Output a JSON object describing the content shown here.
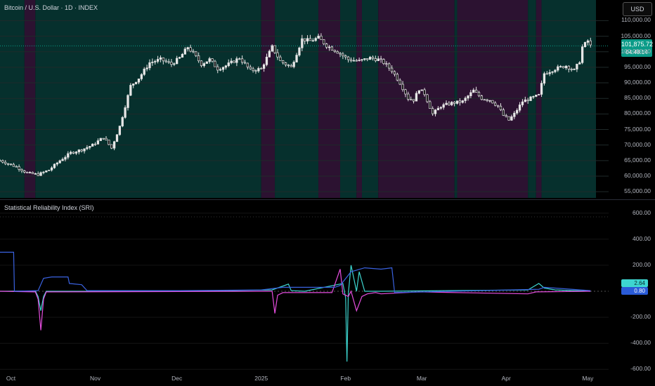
{
  "header": {
    "symbol_title": "Bitcoin / U.S. Dollar · 1D · INDEX",
    "currency_button": "USD",
    "indicator_title": "Statistical Reliability Index (SRI)"
  },
  "price_tag": {
    "value": "101,875.72",
    "countdown": "04:48:14"
  },
  "value_tags": {
    "a": "2.64",
    "b": "0.80"
  },
  "colors": {
    "bull_regime": "#06302d",
    "bear_regime": "#2c1231",
    "candle": "#e6e6e6",
    "line_cyan": "#3dd6d0",
    "line_magenta": "#e64ddf",
    "line_blue": "#3a62e0",
    "accent": "#0b9b88"
  },
  "chart_data": [
    {
      "type": "candlestick",
      "title": "Bitcoin / U.S. Dollar · 1D · INDEX",
      "ylim": [
        53000,
        111000
      ],
      "y_ticks": [
        "110,000.00",
        "105,000.00",
        "100,000.00",
        "95,000.00",
        "90,000.00",
        "85,000.00",
        "80,000.00",
        "75,000.00",
        "70,000.00",
        "65,000.00",
        "60,000.00",
        "55,000.00"
      ],
      "y_tick_values": [
        110000,
        105000,
        100000,
        95000,
        90000,
        85000,
        80000,
        75000,
        70000,
        65000,
        60000,
        55000
      ],
      "x_ticks": [
        "Oct",
        "Nov",
        "Dec",
        "2025",
        "Feb",
        "Mar",
        "Apr",
        "May"
      ],
      "x_tick_days": [
        0,
        31,
        61,
        92,
        123,
        151,
        182,
        212
      ],
      "x_range_days": [
        -4,
        226
      ],
      "last_price": 101875.72,
      "price_anchors": [
        [
          -4,
          65000
        ],
        [
          2,
          63000
        ],
        [
          6,
          61000
        ],
        [
          10,
          60500
        ],
        [
          14,
          62000
        ],
        [
          18,
          65000
        ],
        [
          22,
          67500
        ],
        [
          26,
          68500
        ],
        [
          30,
          70000
        ],
        [
          34,
          72500
        ],
        [
          37,
          69000
        ],
        [
          40,
          76000
        ],
        [
          44,
          89000
        ],
        [
          47,
          91500
        ],
        [
          51,
          96500
        ],
        [
          55,
          97500
        ],
        [
          59,
          96000
        ],
        [
          62,
          98000
        ],
        [
          65,
          101500
        ],
        [
          67,
          99500
        ],
        [
          70,
          96000
        ],
        [
          73,
          97500
        ],
        [
          76,
          94500
        ],
        [
          79,
          95500
        ],
        [
          84,
          98000
        ],
        [
          88,
          94000
        ],
        [
          92,
          94500
        ],
        [
          96,
          101500
        ],
        [
          99,
          97000
        ],
        [
          103,
          95000
        ],
        [
          107,
          104000
        ],
        [
          110,
          103500
        ],
        [
          113,
          104500
        ],
        [
          116,
          102000
        ],
        [
          120,
          100000
        ],
        [
          124,
          97500
        ],
        [
          128,
          97000
        ],
        [
          132,
          98000
        ],
        [
          135,
          97500
        ],
        [
          137,
          96500
        ],
        [
          140,
          94000
        ],
        [
          143,
          90000
        ],
        [
          146,
          85000
        ],
        [
          148,
          84500
        ],
        [
          150,
          88000
        ],
        [
          152,
          86500
        ],
        [
          155,
          80000
        ],
        [
          158,
          82500
        ],
        [
          162,
          83500
        ],
        [
          166,
          84000
        ],
        [
          170,
          87500
        ],
        [
          173,
          85000
        ],
        [
          176,
          84500
        ],
        [
          179,
          82500
        ],
        [
          181,
          79500
        ],
        [
          183,
          78000
        ],
        [
          185,
          80000
        ],
        [
          188,
          84000
        ],
        [
          191,
          85000
        ],
        [
          194,
          86000
        ],
        [
          196,
          93000
        ],
        [
          200,
          94500
        ],
        [
          204,
          95500
        ],
        [
          207,
          94000
        ],
        [
          209,
          97000
        ],
        [
          210,
          101500
        ],
        [
          212,
          103500
        ],
        [
          213,
          101875.72
        ]
      ],
      "regimes": [
        {
          "start": -4,
          "end": 5,
          "state": "bull"
        },
        {
          "start": 5,
          "end": 9,
          "state": "bear"
        },
        {
          "start": 9,
          "end": 92,
          "state": "bull"
        },
        {
          "start": 92,
          "end": 97,
          "state": "bear"
        },
        {
          "start": 97,
          "end": 113,
          "state": "bull"
        },
        {
          "start": 113,
          "end": 121,
          "state": "bear"
        },
        {
          "start": 121,
          "end": 127,
          "state": "bull"
        },
        {
          "start": 127,
          "end": 129,
          "state": "bear"
        },
        {
          "start": 129,
          "end": 135,
          "state": "bull"
        },
        {
          "start": 135,
          "end": 163,
          "state": "bear"
        },
        {
          "start": 163,
          "end": 164,
          "state": "bull"
        },
        {
          "start": 164,
          "end": 190,
          "state": "bear"
        },
        {
          "start": 190,
          "end": 193,
          "state": "bull"
        },
        {
          "start": 193,
          "end": 195,
          "state": "bear"
        },
        {
          "start": 195,
          "end": 215,
          "state": "bull"
        }
      ]
    },
    {
      "type": "line",
      "title": "Statistical Reliability Index (SRI)",
      "ylim": [
        -620,
        620
      ],
      "y_ticks": [
        "600.00",
        "400.00",
        "200.00",
        "-200.00",
        "-400.00",
        "-600.00"
      ],
      "y_tick_values": [
        600,
        400,
        200,
        -200,
        -400,
        -600
      ],
      "last_values": [
        2.64,
        0.8
      ],
      "series": [
        {
          "color_key": "line_cyan",
          "points": [
            [
              -4,
              0
            ],
            [
              9,
              2
            ],
            [
              10,
              -40
            ],
            [
              11,
              -150
            ],
            [
              12,
              -40
            ],
            [
              13,
              0
            ],
            [
              62,
              0
            ],
            [
              96,
              10
            ],
            [
              102,
              55
            ],
            [
              103,
              5
            ],
            [
              108,
              0
            ],
            [
              122,
              60
            ],
            [
              123,
              -50
            ],
            [
              123.5,
              -540
            ],
            [
              124,
              -20
            ],
            [
              125,
              200
            ],
            [
              127,
              0
            ],
            [
              128,
              150
            ],
            [
              130,
              0
            ],
            [
              136,
              0
            ],
            [
              190,
              10
            ],
            [
              194,
              60
            ],
            [
              196,
              25
            ],
            [
              200,
              10
            ],
            [
              213,
              0
            ]
          ]
        },
        {
          "color_key": "line_magenta",
          "points": [
            [
              -4,
              0
            ],
            [
              9,
              -5
            ],
            [
              10,
              -60
            ],
            [
              11,
              -300
            ],
            [
              12,
              -60
            ],
            [
              13,
              -5
            ],
            [
              96,
              0
            ],
            [
              97,
              -170
            ],
            [
              98,
              -30
            ],
            [
              100,
              -10
            ],
            [
              118,
              -10
            ],
            [
              121,
              170
            ],
            [
              122,
              -20
            ],
            [
              124,
              -40
            ],
            [
              125,
              0
            ],
            [
              127,
              -150
            ],
            [
              129,
              -40
            ],
            [
              131,
              -20
            ],
            [
              134,
              -10
            ],
            [
              136,
              -20
            ],
            [
              150,
              -5
            ],
            [
              190,
              -20
            ],
            [
              193,
              -5
            ],
            [
              213,
              0
            ]
          ]
        },
        {
          "color_key": "line_blue",
          "points": [
            [
              -4,
              300
            ],
            [
              1,
              300
            ],
            [
              1.3,
              0
            ],
            [
              10,
              5
            ],
            [
              12,
              100
            ],
            [
              15,
              110
            ],
            [
              21,
              110
            ],
            [
              21.5,
              60
            ],
            [
              26,
              50
            ],
            [
              28,
              5
            ],
            [
              62,
              5
            ],
            [
              92,
              10
            ],
            [
              100,
              30
            ],
            [
              119,
              30
            ],
            [
              121,
              45
            ],
            [
              125,
              150
            ],
            [
              130,
              180
            ],
            [
              136,
              170
            ],
            [
              140,
              180
            ],
            [
              141,
              -10
            ],
            [
              194,
              15
            ],
            [
              196,
              30
            ],
            [
              213,
              5
            ]
          ]
        }
      ]
    }
  ]
}
